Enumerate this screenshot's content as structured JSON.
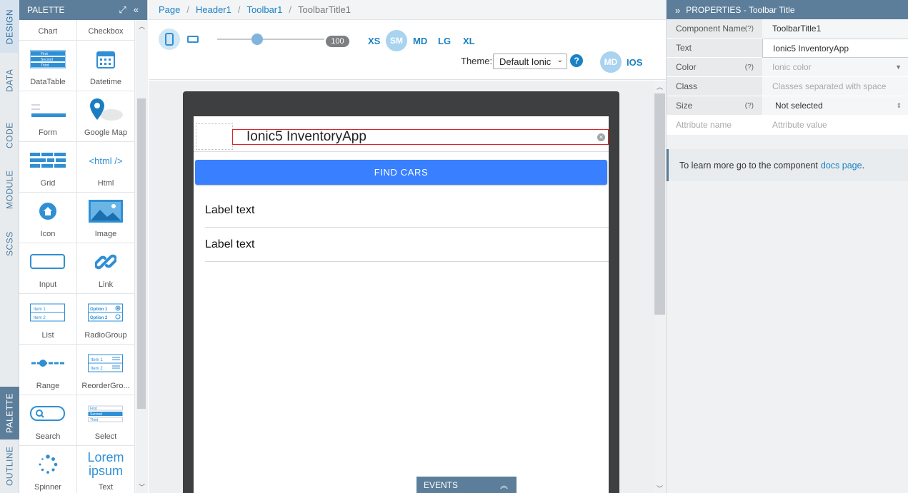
{
  "rail": {
    "tabs": [
      "DESIGN",
      "DATA",
      "CODE",
      "MODULE",
      "SCSS",
      "PALETTE",
      "OUTLINE"
    ]
  },
  "palette": {
    "title": "PALETTE",
    "items": [
      "Chart",
      "Checkbox",
      "DataTable",
      "Datetime",
      "Form",
      "Google Map",
      "Grid",
      "Html",
      "Icon",
      "Image",
      "Input",
      "Link",
      "List",
      "RadioGroup",
      "Range",
      "ReorderGro...",
      "Search",
      "Select",
      "Spinner",
      "Text"
    ],
    "html_icon_text": "<html />",
    "text_icon_line1": "Lorem",
    "text_icon_line2": "ipsum",
    "datatable_rows": [
      "First",
      "Second",
      "Third"
    ],
    "list_rows": [
      "Item 1",
      "Item 2"
    ],
    "radio_rows": [
      "Option 1",
      "Option 2"
    ]
  },
  "breadcrumb": {
    "items": [
      "Page",
      "Header1",
      "Toolbar1"
    ],
    "current": "ToolbarTitle1"
  },
  "toolbar": {
    "zoom_value": "100",
    "breakpoints": [
      "XS",
      "SM",
      "MD",
      "LG",
      "XL"
    ],
    "active_breakpoint": "SM",
    "theme_label": "Theme:",
    "theme_value": "Default Ionic",
    "help_glyph": "?",
    "mode_md": "MD",
    "mode_ios": "IOS"
  },
  "canvas": {
    "toolbar_title": "Ionic5 InventoryApp",
    "button_label": "FIND CARS",
    "labels": [
      "Label text",
      "Label text"
    ],
    "events_label": "EVENTS"
  },
  "properties": {
    "title": "PROPERTIES - Toolbar Title",
    "rows": [
      {
        "key": "Component Name",
        "help": "(?)",
        "value": "ToolbarTitle1"
      },
      {
        "key": "Text",
        "help": "",
        "value": "Ionic5 InventoryApp"
      },
      {
        "key": "Color",
        "help": "(?)",
        "value": "Ionic color"
      },
      {
        "key": "Class",
        "help": "",
        "value": "Classes separated with space"
      },
      {
        "key": "Size",
        "help": "(?)",
        "value": "Not selected"
      },
      {
        "key": "Attribute name",
        "help": "",
        "value": "Attribute value"
      }
    ],
    "info_text": "To learn more go to the component",
    "info_link": "docs page",
    "info_period": "."
  },
  "colors": {
    "accent": "#1a82c4",
    "header": "#5c7e9a",
    "ionic_primary": "#3880ff",
    "selection": "#d7262b"
  }
}
